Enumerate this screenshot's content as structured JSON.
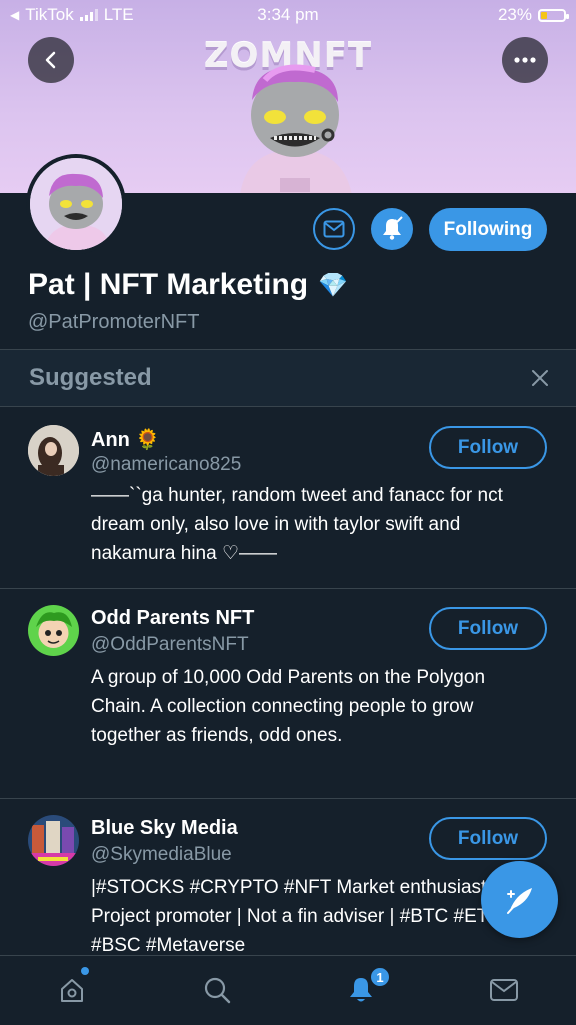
{
  "status_bar": {
    "back_app": "TikTok",
    "network": "LTE",
    "time": "3:34 pm",
    "battery": "23%"
  },
  "banner": {
    "title": "ZOMNFT"
  },
  "profile": {
    "name": "Pat | NFT Marketing",
    "handle": "@PatPromoterNFT",
    "following_label": "Following",
    "verified_emoji": "💎"
  },
  "suggested": {
    "title": "Suggested",
    "items": [
      {
        "name": "Ann 🌻",
        "handle": "@namericano825",
        "bio": "——``ga hunter, random tweet and fanacc for nct dream only, also love in with taylor swift and nakamura hina ♡——",
        "follow_label": "Follow"
      },
      {
        "name": "Odd Parents NFT",
        "handle": "@OddParentsNFT",
        "bio": "A group of 10,000 Odd Parents on the Polygon Chain. A collection connecting people to grow together as friends, odd ones.",
        "follow_label": "Follow"
      },
      {
        "name": "Blue Sky Media",
        "handle": "@SkymediaBlue",
        "bio": "|#STOCKS #CRYPTO #NFT Market enthusiast | Project promoter | Not a fin adviser | #BTC #ETH #BSC #Metaverse",
        "follow_label": "Follow"
      }
    ]
  },
  "tabbar": {
    "notification_count": "1"
  },
  "colors": {
    "background": "#15202b",
    "accent": "#3a97e6",
    "secondary_text": "#8899a6",
    "divider": "#38444d"
  }
}
